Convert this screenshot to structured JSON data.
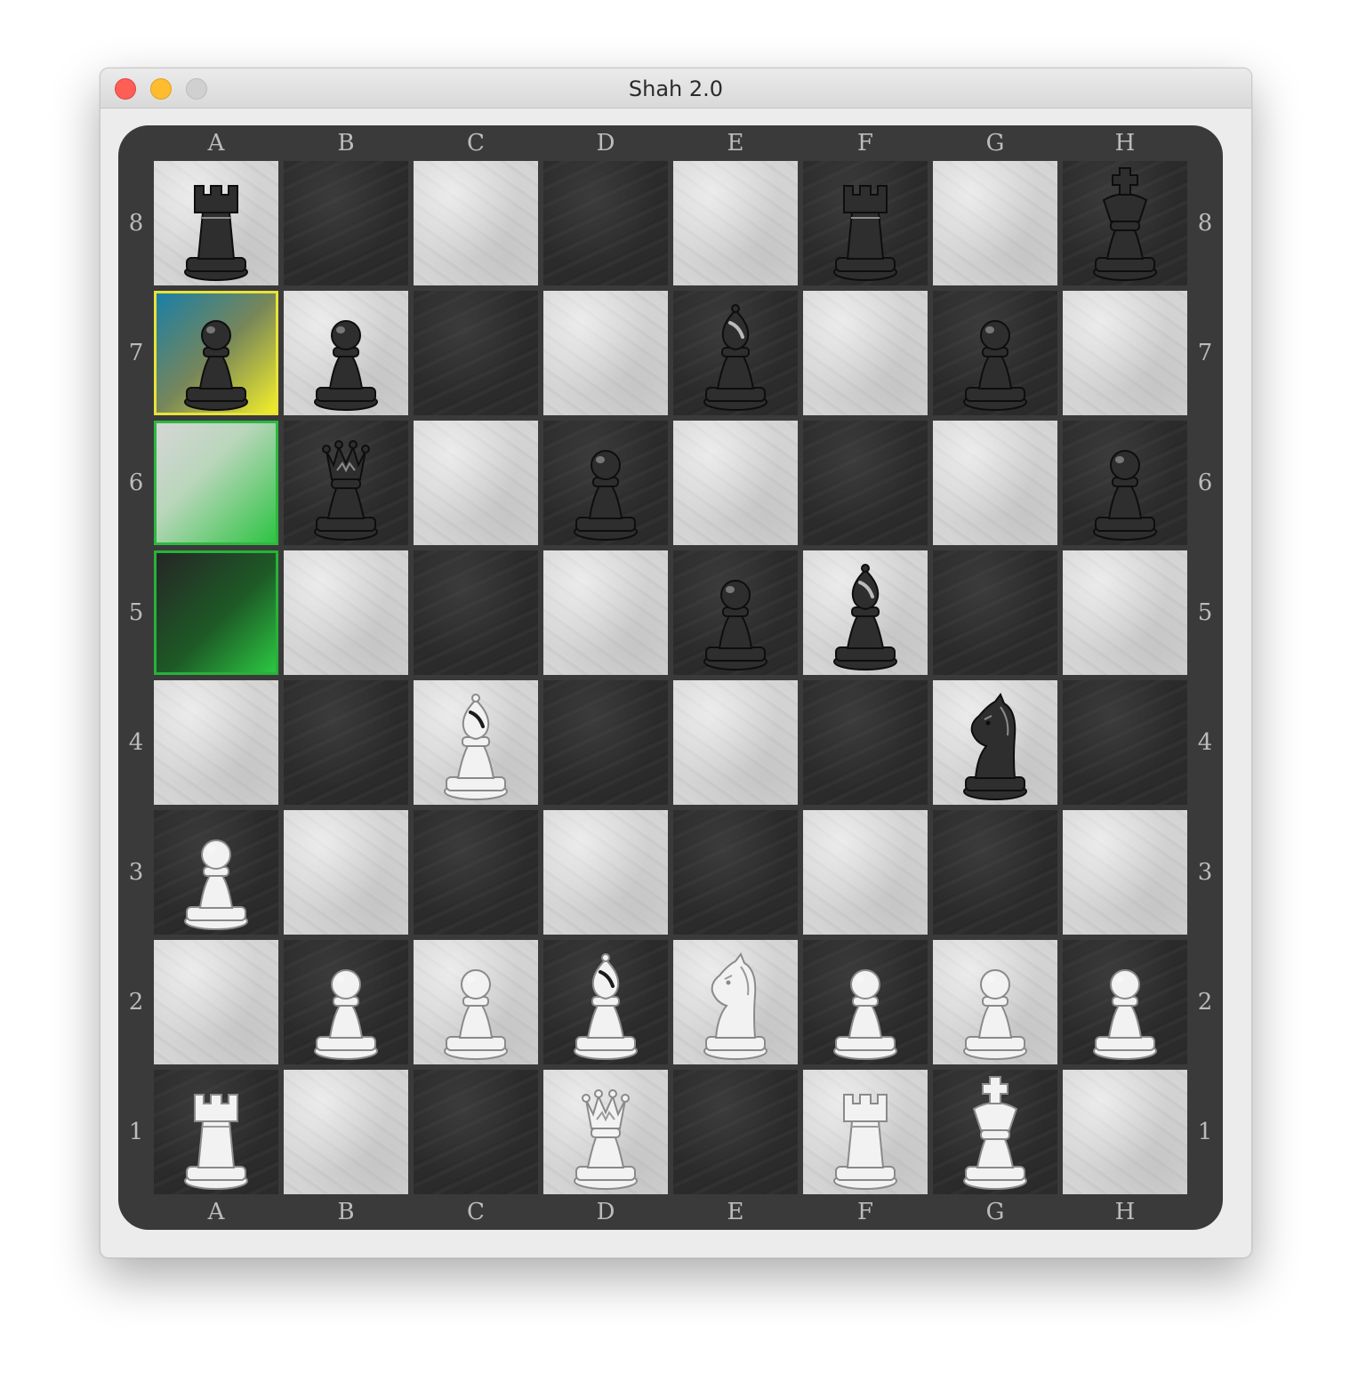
{
  "window": {
    "title": "Shah 2.0"
  },
  "board": {
    "files": [
      "A",
      "B",
      "C",
      "D",
      "E",
      "F",
      "G",
      "H"
    ],
    "ranks": [
      "8",
      "7",
      "6",
      "5",
      "4",
      "3",
      "2",
      "1"
    ],
    "selected_square": "a7",
    "move_target_squares": [
      "a6",
      "a5"
    ],
    "pieces": [
      {
        "square": "a8",
        "color": "black",
        "type": "rook"
      },
      {
        "square": "f8",
        "color": "black",
        "type": "rook"
      },
      {
        "square": "h8",
        "color": "black",
        "type": "king"
      },
      {
        "square": "a7",
        "color": "black",
        "type": "pawn"
      },
      {
        "square": "b7",
        "color": "black",
        "type": "pawn"
      },
      {
        "square": "e7",
        "color": "black",
        "type": "bishop"
      },
      {
        "square": "g7",
        "color": "black",
        "type": "pawn"
      },
      {
        "square": "b6",
        "color": "black",
        "type": "queen"
      },
      {
        "square": "d6",
        "color": "black",
        "type": "pawn"
      },
      {
        "square": "h6",
        "color": "black",
        "type": "pawn"
      },
      {
        "square": "e5",
        "color": "black",
        "type": "pawn"
      },
      {
        "square": "f5",
        "color": "black",
        "type": "bishop"
      },
      {
        "square": "c4",
        "color": "white",
        "type": "bishop"
      },
      {
        "square": "g4",
        "color": "black",
        "type": "knight"
      },
      {
        "square": "a3",
        "color": "white",
        "type": "pawn"
      },
      {
        "square": "b2",
        "color": "white",
        "type": "pawn"
      },
      {
        "square": "c2",
        "color": "white",
        "type": "pawn"
      },
      {
        "square": "d2",
        "color": "white",
        "type": "bishop"
      },
      {
        "square": "e2",
        "color": "white",
        "type": "knight"
      },
      {
        "square": "f2",
        "color": "white",
        "type": "pawn"
      },
      {
        "square": "g2",
        "color": "white",
        "type": "pawn"
      },
      {
        "square": "h2",
        "color": "white",
        "type": "pawn"
      },
      {
        "square": "a1",
        "color": "white",
        "type": "rook"
      },
      {
        "square": "d1",
        "color": "white",
        "type": "queen"
      },
      {
        "square": "f1",
        "color": "white",
        "type": "rook"
      },
      {
        "square": "g1",
        "color": "white",
        "type": "king"
      }
    ]
  },
  "colors": {
    "light_square": "#d4d4d4",
    "dark_square": "#2b2b2b",
    "board_border": "#3a3a3a",
    "selected_highlight": "#f2ee2a",
    "move_highlight": "#2ec443"
  }
}
